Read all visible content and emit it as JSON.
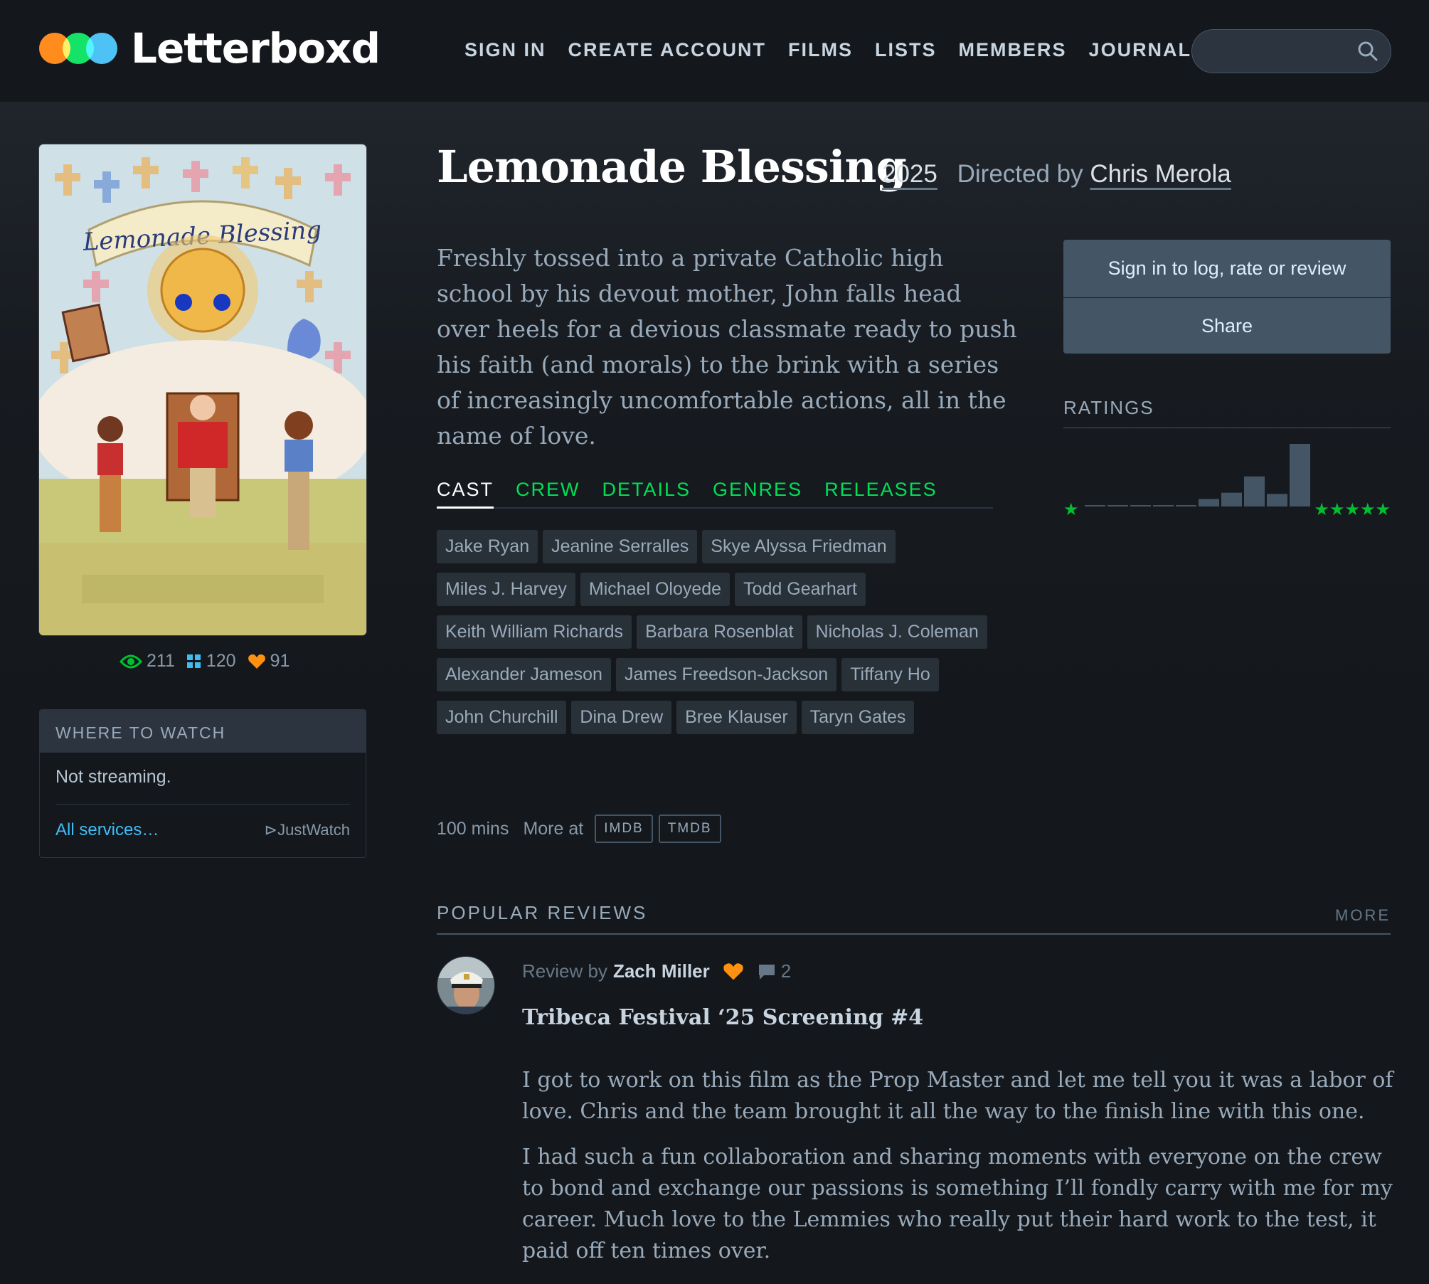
{
  "header": {
    "logo_text": "Letterboxd",
    "logo_colors": [
      "#ff8000",
      "#00e054",
      "#40bcf4"
    ],
    "nav": [
      "SIGN IN",
      "CREATE ACCOUNT",
      "FILMS",
      "LISTS",
      "MEMBERS",
      "JOURNAL"
    ],
    "search_icon": "search-icon"
  },
  "film": {
    "title": "Lemonade Blessing",
    "year": "2025",
    "directed_by_label": "Directed by",
    "director": "Chris Merola",
    "synopsis": "Freshly tossed into a private Catholic high school by his devout mother, John falls head over heels for a devious classmate ready to push his faith (and morals) to the brink with a series of increasingly uncomfortable actions, all in the name of love.",
    "poster_title": "Lemonade Blessing",
    "stats": {
      "watched": "211",
      "lists": "120",
      "likes": "91"
    },
    "runtime": "100 mins",
    "more_at_label": "More at",
    "external": [
      "IMDB",
      "TMDB"
    ]
  },
  "where_to_watch": {
    "heading": "WHERE TO WATCH",
    "status": "Not streaming.",
    "all_services": "All services…",
    "provider": "JustWatch"
  },
  "tabs": [
    "CAST",
    "CREW",
    "DETAILS",
    "GENRES",
    "RELEASES"
  ],
  "cast": [
    "Jake Ryan",
    "Jeanine Serralles",
    "Skye Alyssa Friedman",
    "Miles J. Harvey",
    "Michael Oloyede",
    "Todd Gearhart",
    "Keith William Richards",
    "Barbara Rosenblat",
    "Nicholas J. Coleman",
    "Alexander Jameson",
    "James Freedson-Jackson",
    "Tiffany Ho",
    "John Churchill",
    "Dina Drew",
    "Bree Klauser",
    "Taryn Gates"
  ],
  "actions": {
    "log": "Sign in to log, rate or review",
    "share": "Share"
  },
  "ratings": {
    "heading": "RATINGS",
    "low_star": "★",
    "high_stars": "★★★★★",
    "accent": "#00c030",
    "distribution": [
      0.02,
      0.02,
      0.02,
      0.02,
      0.02,
      0.12,
      0.22,
      0.48,
      0.2,
      1.0
    ]
  },
  "reviews": {
    "heading": "POPULAR REVIEWS",
    "more": "MORE",
    "items": [
      {
        "by_label": "Review by",
        "author": "Zach Miller",
        "comments": "2",
        "title": "Tribeca Festival ‘25 Screening #4",
        "paragraphs": [
          "I got to work on this film as the Prop Master and let me tell you it was a labor of love. Chris and the team brought it all the way to the finish line with this one.",
          "I had such a fun collaboration and sharing moments with everyone on the crew to bond and exchange our passions is something I’ll fondly carry with me for my career. Much love to the Lemmies who really put their hard work to the test, it paid off ten times over."
        ]
      }
    ]
  }
}
